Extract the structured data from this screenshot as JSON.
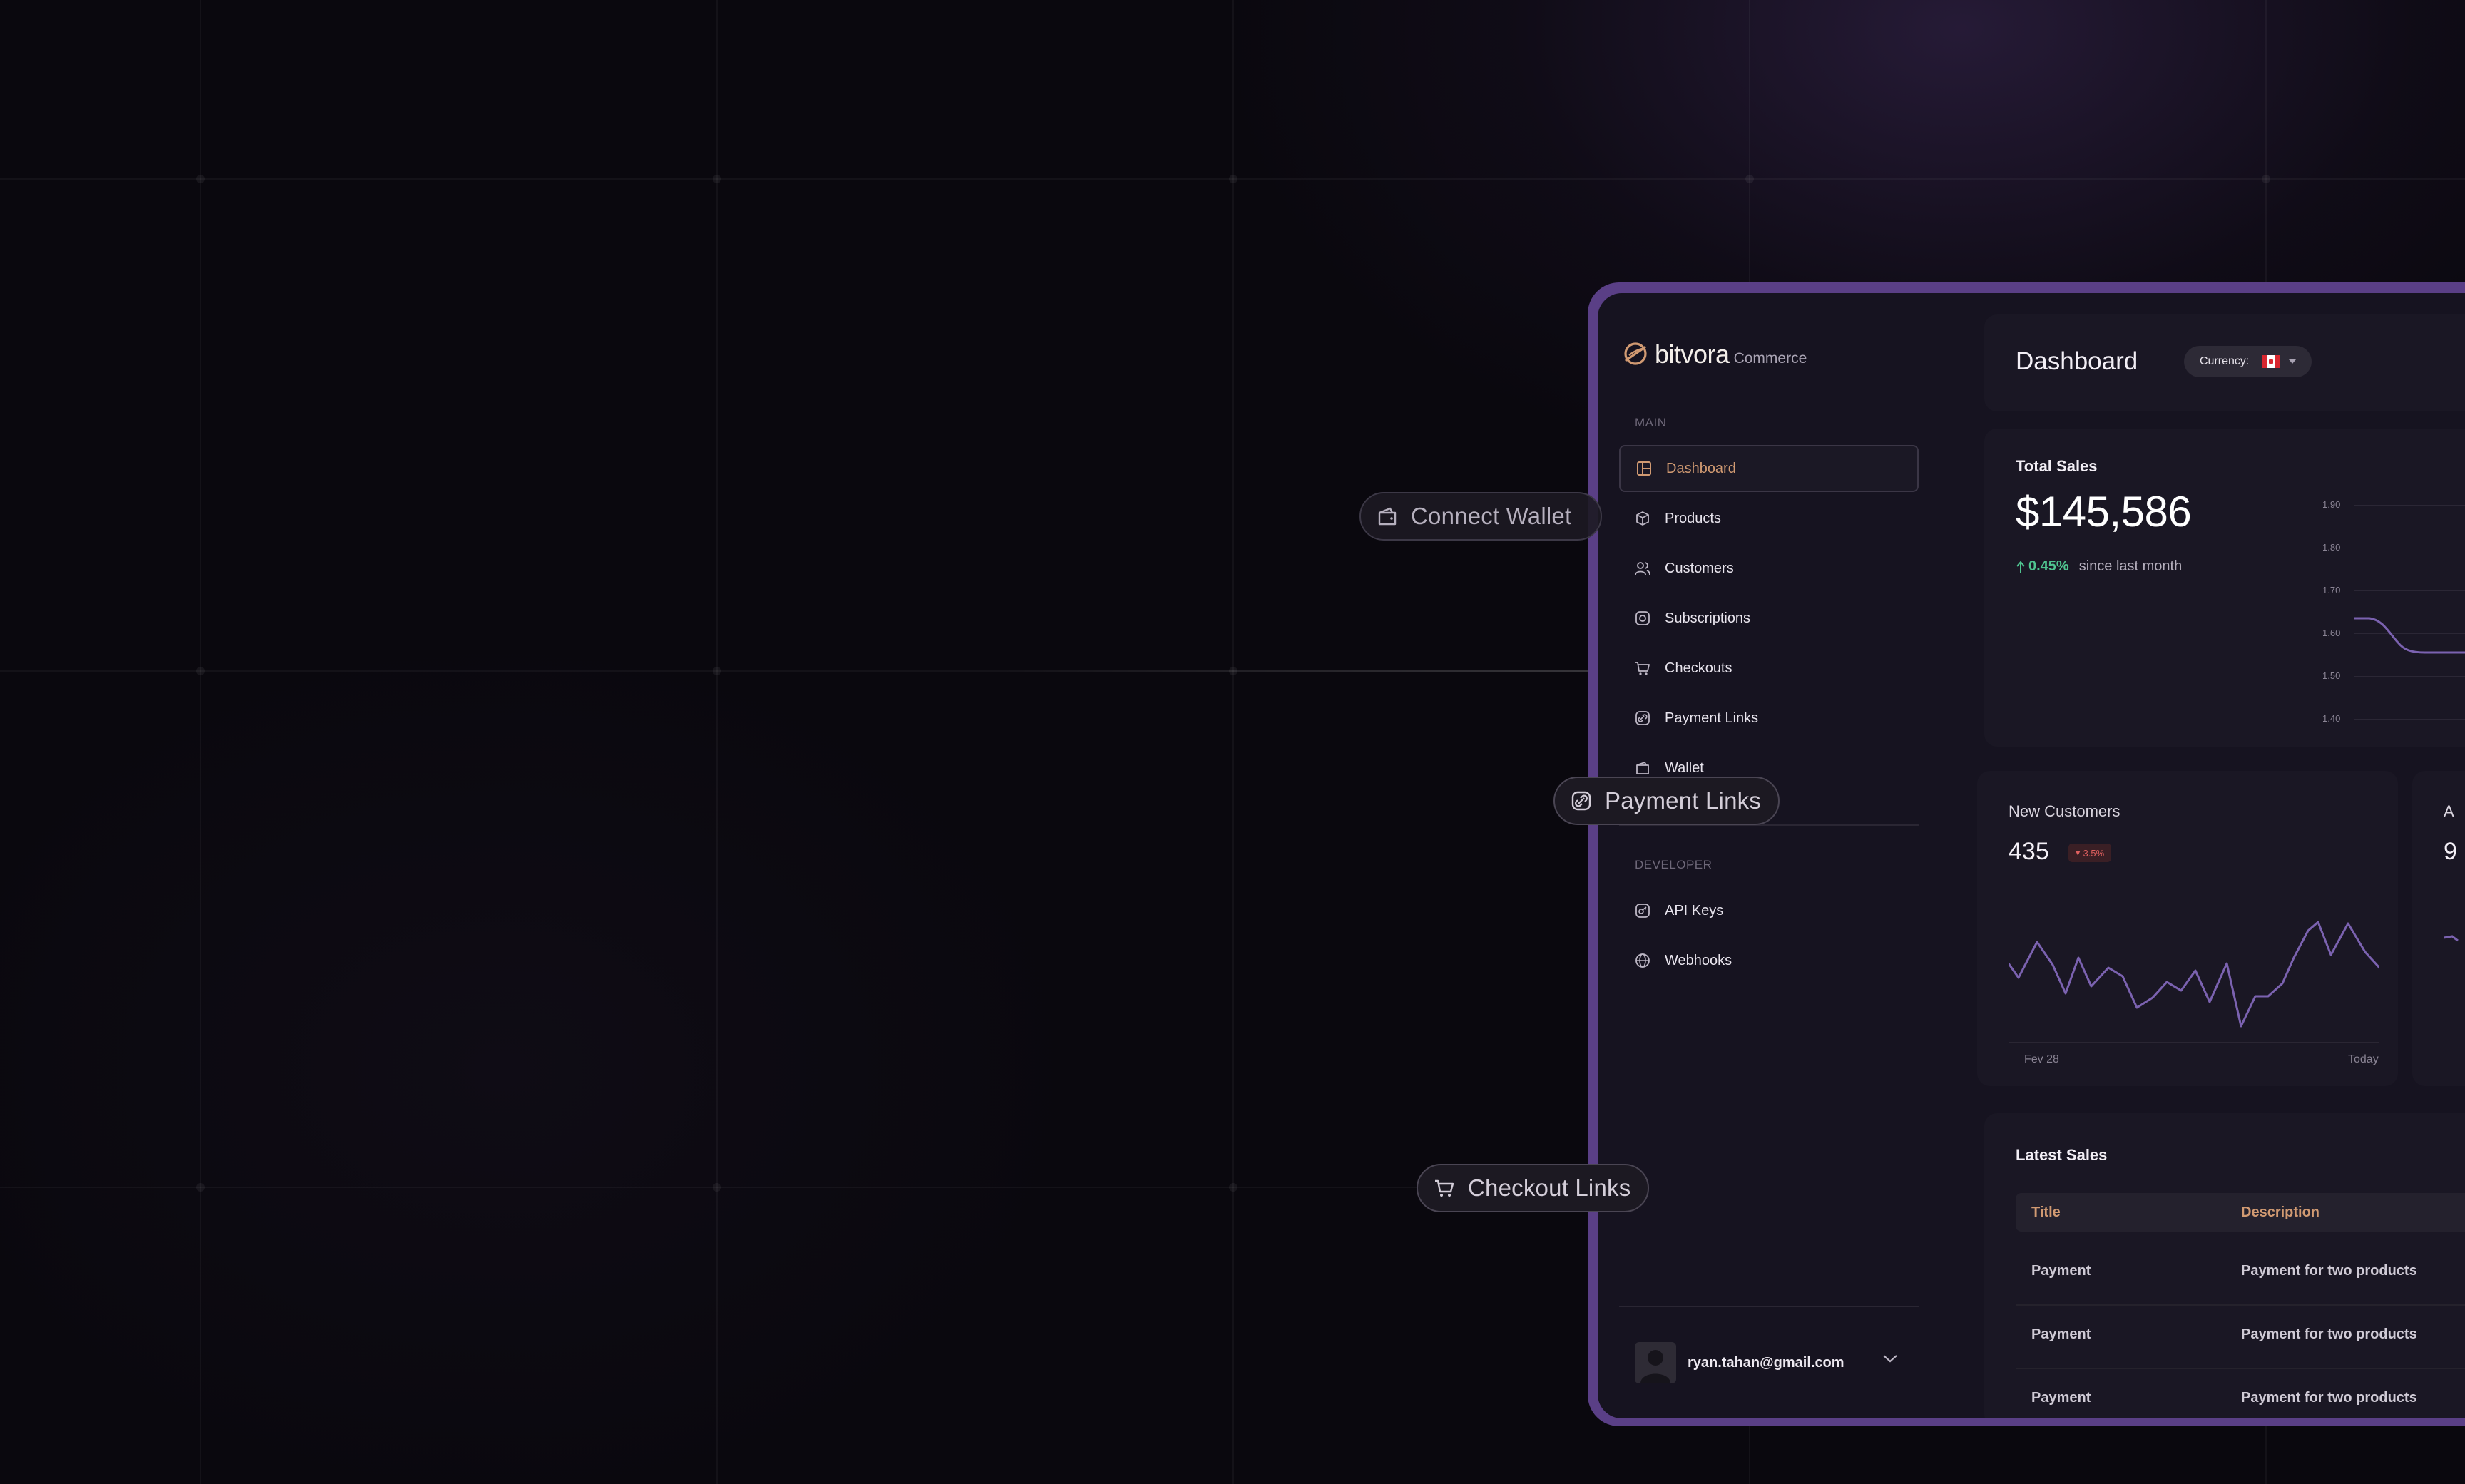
{
  "brand": {
    "name": "bitvora",
    "suffix": "Commerce",
    "accent": "#d19a72"
  },
  "sidebar": {
    "main_label": "MAIN",
    "items": [
      {
        "label": "Dashboard",
        "icon": "dashboard-icon",
        "active": true
      },
      {
        "label": "Products",
        "icon": "box-icon"
      },
      {
        "label": "Customers",
        "icon": "users-icon"
      },
      {
        "label": "Subscriptions",
        "icon": "subscription-icon"
      },
      {
        "label": "Checkouts",
        "icon": "cart-icon"
      },
      {
        "label": "Payment Links",
        "icon": "link-icon"
      },
      {
        "label": "Wallet",
        "icon": "wallet-icon"
      }
    ],
    "developer_label": "DEVELOPER",
    "dev_items": [
      {
        "label": "API Keys",
        "icon": "key-icon"
      },
      {
        "label": "Webhooks",
        "icon": "globe-icon"
      }
    ],
    "user_email": "ryan.tahan@gmail.com"
  },
  "header": {
    "title": "Dashboard",
    "currency_label": "Currency:"
  },
  "total_sales": {
    "title": "Total Sales",
    "value": "$145,586",
    "change_pct": "0.45%",
    "change_text": "since last month",
    "y_ticks": [
      "1.90",
      "1.80",
      "1.70",
      "1.60",
      "1.50",
      "1.40"
    ]
  },
  "new_customers": {
    "title": "New Customers",
    "value": "435",
    "badge": "3.5%",
    "x_start": "Fev 28",
    "x_end": "Today",
    "line_color": "#7b62b0"
  },
  "side_card": {
    "title": "A",
    "value": "9"
  },
  "latest_sales": {
    "title": "Latest Sales",
    "columns": [
      "Title",
      "Description"
    ],
    "rows": [
      [
        "Payment",
        "Payment for two products"
      ],
      [
        "Payment",
        "Payment for two products"
      ],
      [
        "Payment",
        "Payment for two products"
      ]
    ]
  },
  "floating_pills": {
    "connect_wallet": "Connect Wallet",
    "payment_links": "Payment Links",
    "checkout_links": "Checkout Links"
  }
}
